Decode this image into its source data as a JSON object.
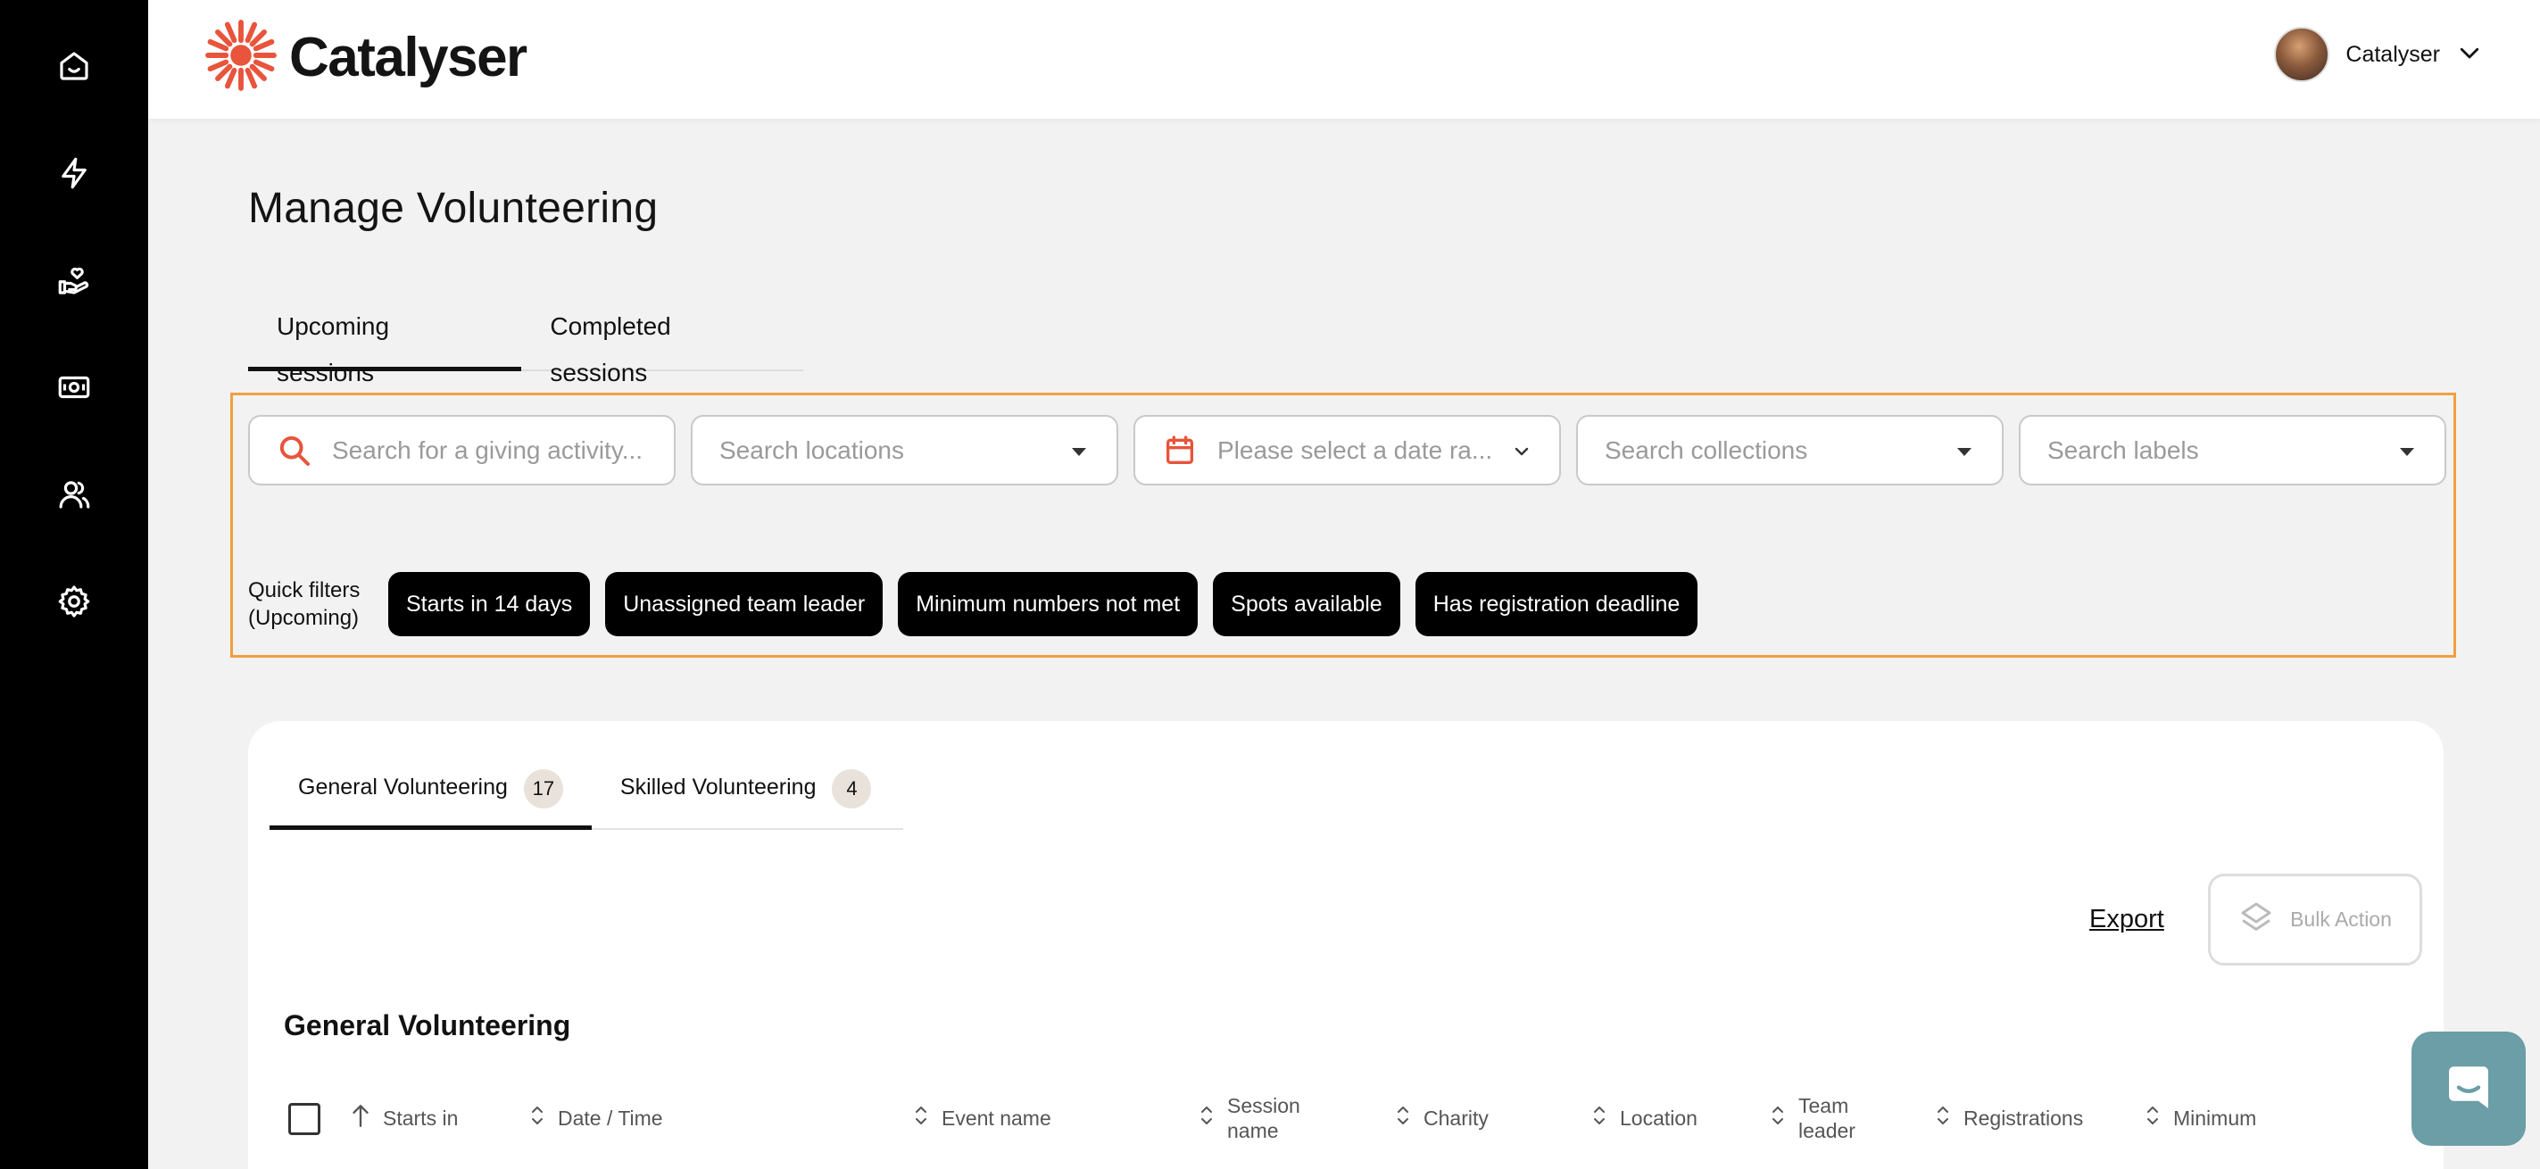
{
  "brand": {
    "name": "Catalyser",
    "accent": "#e8543c"
  },
  "user": {
    "name": "Catalyser"
  },
  "sidebar": {
    "items": [
      {
        "name": "home",
        "icon": "home-icon"
      },
      {
        "name": "activity",
        "icon": "lightning-icon"
      },
      {
        "name": "volunteering",
        "icon": "hand-heart-icon"
      },
      {
        "name": "giving",
        "icon": "money-icon"
      },
      {
        "name": "people",
        "icon": "users-icon"
      },
      {
        "name": "settings",
        "icon": "gear-icon"
      }
    ]
  },
  "page": {
    "title": "Manage Volunteering",
    "tabs": [
      {
        "label": "Upcoming sessions",
        "active": true
      },
      {
        "label": "Completed sessions",
        "active": false
      }
    ]
  },
  "filters": {
    "search_placeholder": "Search for a giving activity...",
    "locations": "Search locations",
    "date_range": "Please select a date ra...",
    "collections": "Search collections",
    "labels": "Search labels",
    "quick_filters_label": "Quick filters (Upcoming)",
    "quick": [
      "Starts in 14 days",
      "Unassigned team leader",
      "Minimum numbers not met",
      "Spots available",
      "Has registration deadline"
    ],
    "highlight_color": "#f0a040"
  },
  "card": {
    "tabs": [
      {
        "label": "General Volunteering",
        "count": "17",
        "active": true
      },
      {
        "label": "Skilled Volunteering",
        "count": "4",
        "active": false
      }
    ],
    "export_label": "Export",
    "bulk_action_label": "Bulk Action",
    "section_title": "General Volunteering",
    "columns": [
      "Starts in",
      "Date / Time",
      "Event name",
      "Session name",
      "Charity",
      "Location",
      "Team leader",
      "Registrations",
      "Minimum"
    ]
  },
  "chat": {
    "icon": "chat-bubble-icon",
    "color": "#6b9ea6"
  }
}
